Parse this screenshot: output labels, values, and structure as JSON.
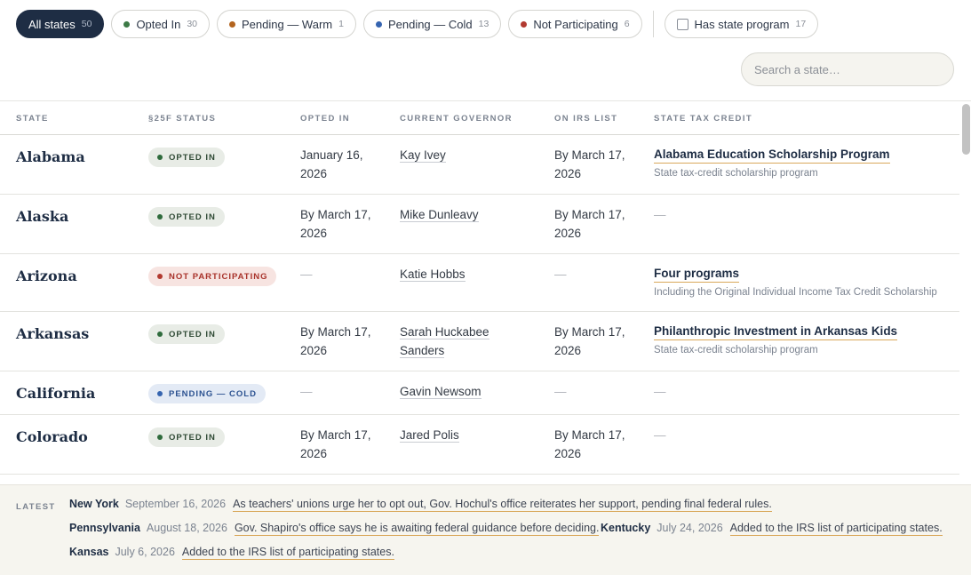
{
  "filters": [
    {
      "label": "All states",
      "count": "50",
      "active": true,
      "dot": null
    },
    {
      "label": "Opted In",
      "count": "30",
      "active": false,
      "dot": "#3d7a46"
    },
    {
      "label": "Pending — Warm",
      "count": "1",
      "active": false,
      "dot": "#b3641e"
    },
    {
      "label": "Pending — Cold",
      "count": "13",
      "active": false,
      "dot": "#3564b0"
    },
    {
      "label": "Not Participating",
      "count": "6",
      "active": false,
      "dot": "#b23a30"
    }
  ],
  "state_program_filter": {
    "label": "Has state program",
    "count": "17",
    "checked": false
  },
  "search": {
    "placeholder": "Search a state…",
    "value": ""
  },
  "table": {
    "headers": {
      "state": "State",
      "status": "§25F Status",
      "opted_in": "Opted In",
      "governor": "Current Governor",
      "irs": "On IRS List",
      "credit": "State Tax Credit"
    },
    "rows": [
      {
        "state": "Alabama",
        "status": "Opted In",
        "status_kind": "opted",
        "opted_in": "January 16, 2026",
        "governor": "Kay Ivey",
        "irs": "By March 17, 2026",
        "credit_title": "Alabama Education Scholarship Program",
        "credit_sub": "State tax-credit scholarship program"
      },
      {
        "state": "Alaska",
        "status": "Opted In",
        "status_kind": "opted",
        "opted_in": "By March 17, 2026",
        "governor": "Mike Dunleavy",
        "irs": "By March 17, 2026",
        "credit_title": "",
        "credit_sub": "",
        "credit_dash": "—"
      },
      {
        "state": "Arizona",
        "status": "Not Participating",
        "status_kind": "notp",
        "opted_in": "—",
        "governor": "Katie Hobbs",
        "irs": "—",
        "credit_title": "Four programs",
        "credit_sub": "Including the Original Individual Income Tax Credit Scholarship"
      },
      {
        "state": "Arkansas",
        "status": "Opted In",
        "status_kind": "opted",
        "opted_in": "By March 17, 2026",
        "governor": "Sarah Huckabee Sanders",
        "irs": "By March 17, 2026",
        "credit_title": "Philanthropic Investment in Arkansas Kids",
        "credit_sub": "State tax-credit scholarship program"
      },
      {
        "state": "California",
        "status": "Pending — Cold",
        "status_kind": "cold",
        "opted_in": "—",
        "governor": "Gavin Newsom",
        "irs": "—",
        "credit_title": "",
        "credit_sub": "",
        "credit_dash": "—"
      },
      {
        "state": "Colorado",
        "status": "Opted In",
        "status_kind": "opted",
        "opted_in": "By March 17, 2026",
        "governor": "Jared Polis",
        "irs": "By March 17, 2026",
        "credit_title": "",
        "credit_sub": "",
        "credit_dash": "—"
      }
    ]
  },
  "latest": {
    "label": "Latest",
    "items": [
      {
        "state": "New York",
        "date": "September 16, 2026",
        "text": "As teachers' unions urge her to opt out, Gov. Hochul's office reiterates her support, pending final federal rules."
      },
      {
        "state": "Pennsylvania",
        "date": "August 18, 2026",
        "text": "Gov. Shapiro's office says he is awaiting federal guidance before deciding."
      },
      {
        "state": "Kentucky",
        "date": "July 24, 2026",
        "text": "Added to the IRS list of participating states."
      },
      {
        "state": "Kansas",
        "date": "July 6, 2026",
        "text": "Added to the IRS list of participating states."
      }
    ]
  }
}
